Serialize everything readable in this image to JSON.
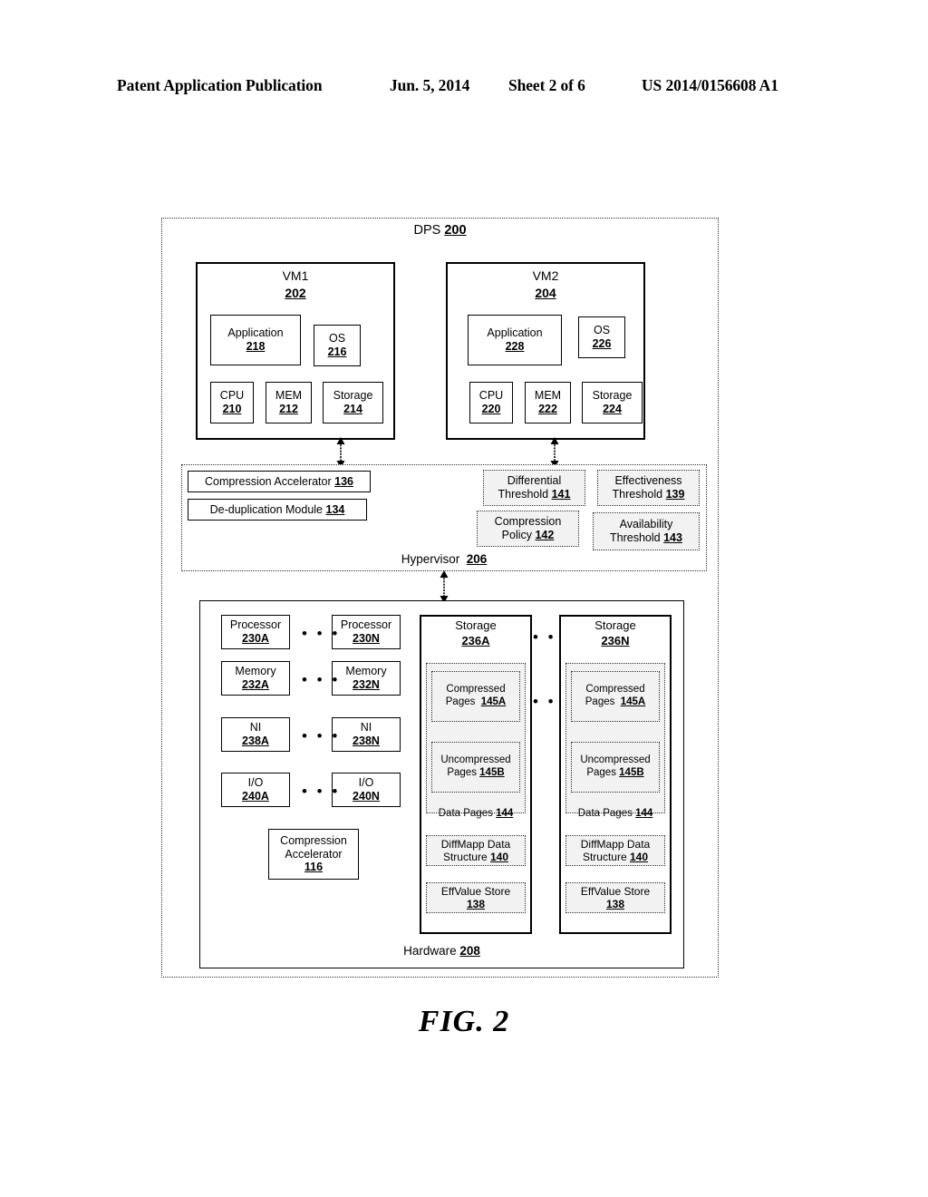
{
  "header": {
    "title": "Patent Application Publication",
    "date": "Jun. 5, 2014",
    "sheet": "Sheet 2 of 6",
    "publication_number": "US 2014/0156608 A1"
  },
  "figure": {
    "caption": "FIG. 2"
  },
  "dps": {
    "label": "DPS",
    "ref": "200"
  },
  "vms": [
    {
      "name": "VM1",
      "ref": "202",
      "application": {
        "label": "Application",
        "ref": "218"
      },
      "os": {
        "label": "OS",
        "ref": "216"
      },
      "cpu": {
        "label": "CPU",
        "ref": "210"
      },
      "mem": {
        "label": "MEM",
        "ref": "212"
      },
      "storage": {
        "label": "Storage",
        "ref": "214"
      }
    },
    {
      "name": "VM2",
      "ref": "204",
      "application": {
        "label": "Application",
        "ref": "228"
      },
      "os": {
        "label": "OS",
        "ref": "226"
      },
      "cpu": {
        "label": "CPU",
        "ref": "220"
      },
      "mem": {
        "label": "MEM",
        "ref": "222"
      },
      "storage": {
        "label": "Storage",
        "ref": "224"
      }
    }
  ],
  "hypervisor": {
    "label": "Hypervisor",
    "ref": "206",
    "compression_accelerator": {
      "label": "Compression Accelerator",
      "ref": "136"
    },
    "deduplication_module": {
      "label": "De-duplication Module",
      "ref": "134"
    },
    "differential_threshold": {
      "line1": "Differential",
      "line2": "Threshold",
      "ref": "141"
    },
    "effectiveness_threshold": {
      "line1": "Effectiveness",
      "line2": "Threshold",
      "ref": "139"
    },
    "compression_policy": {
      "line1": "Compression",
      "line2": "Policy",
      "ref": "142"
    },
    "availability_threshold": {
      "line1": "Availability",
      "line2": "Threshold",
      "ref": "143"
    }
  },
  "hardware": {
    "label": "Hardware",
    "ref": "208",
    "ellipsis": "• • •",
    "processor_a": {
      "label": "Processor",
      "ref": "230A"
    },
    "processor_n": {
      "label": "Processor",
      "ref": "230N"
    },
    "memory_a": {
      "label": "Memory",
      "ref": "232A"
    },
    "memory_n": {
      "label": "Memory",
      "ref": "232N"
    },
    "ni_a": {
      "label": "NI",
      "ref": "238A"
    },
    "ni_n": {
      "label": "NI",
      "ref": "238N"
    },
    "io_a": {
      "label": "I/O",
      "ref": "240A"
    },
    "io_n": {
      "label": "I/O",
      "ref": "240N"
    },
    "compression_accelerator": {
      "line1": "Compression",
      "line2": "Accelerator",
      "ref": "116"
    },
    "storage_a": {
      "label": "Storage",
      "ref": "236A",
      "compressed_pages": {
        "line1": "Compressed",
        "line2": "Pages",
        "ref": "145A"
      },
      "uncompressed_pages": {
        "line1": "Uncompressed",
        "line2": "Pages",
        "ref": "145B"
      },
      "data_pages": {
        "label": "Data Pages",
        "ref": "144"
      },
      "diffmapp": {
        "line1": "DiffMapp Data",
        "line2": "Structure",
        "ref": "140"
      },
      "effvalue_store": {
        "label": "EffValue Store",
        "ref": "138"
      }
    },
    "storage_n": {
      "label": "Storage",
      "ref": "236N",
      "compressed_pages": {
        "line1": "Compressed",
        "line2": "Pages",
        "ref": "145A"
      },
      "uncompressed_pages": {
        "line1": "Uncompressed",
        "line2": "Pages",
        "ref": "145B"
      },
      "data_pages": {
        "label": "Data Pages",
        "ref": "144"
      },
      "diffmapp": {
        "line1": "DiffMapp Data",
        "line2": "Structure",
        "ref": "140"
      },
      "effvalue_store": {
        "label": "EffValue Store",
        "ref": "138"
      }
    }
  }
}
